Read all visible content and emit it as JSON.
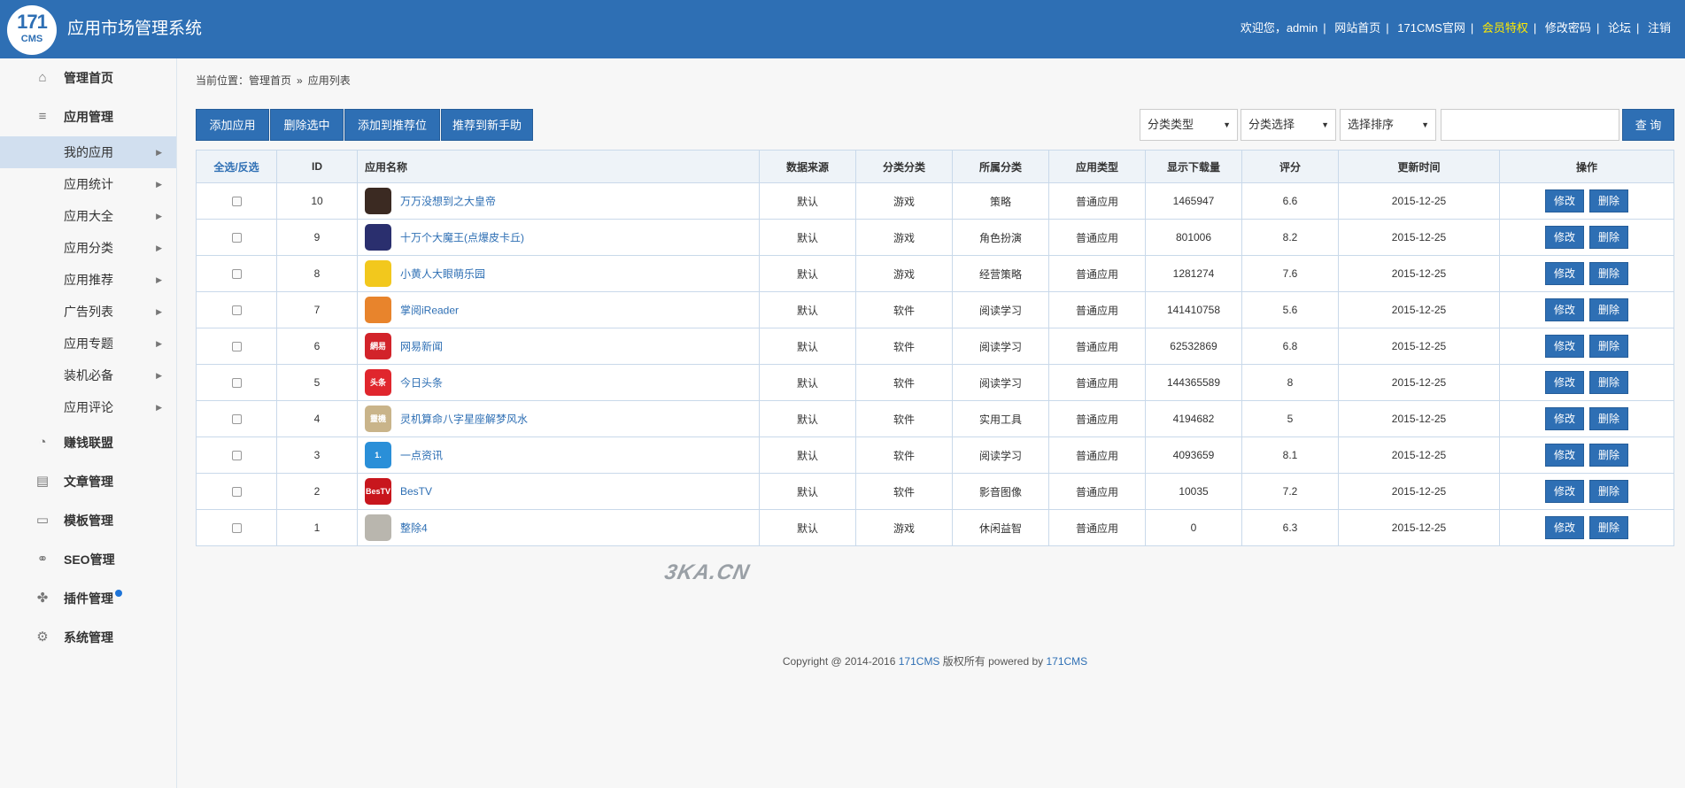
{
  "header": {
    "logo_num": "171",
    "logo_text": "CMS",
    "title": "应用市场管理系统",
    "welcome": "欢迎您，admin",
    "links": [
      "网站首页",
      "171CMS官网",
      "会员特权",
      "修改密码",
      "论坛",
      "注销"
    ]
  },
  "sidebar": {
    "home": "管理首页",
    "app_mgmt": "应用管理",
    "sub_items": [
      "我的应用",
      "应用统计",
      "应用大全",
      "应用分类",
      "应用推荐",
      "广告列表",
      "应用专题",
      "装机必备",
      "应用评论"
    ],
    "money": "赚钱联盟",
    "articles": "文章管理",
    "templates": "模板管理",
    "seo": "SEO管理",
    "plugins": "插件管理",
    "system": "系统管理"
  },
  "breadcrumb": {
    "label": "当前位置：",
    "home": "管理首页",
    "sep": "»",
    "current": "应用列表"
  },
  "toolbar": {
    "add": "添加应用",
    "delete_selected": "删除选中",
    "add_recommend": "添加到推荐位",
    "recommend_new": "推荐到新手助",
    "filter_type": "分类类型",
    "filter_category": "分类选择",
    "filter_sort": "选择排序",
    "search_value": "",
    "search_btn": "查 询"
  },
  "table": {
    "headers": [
      "全选/反选",
      "ID",
      "应用名称",
      "数据来源",
      "分类分类",
      "所属分类",
      "应用类型",
      "显示下载量",
      "评分",
      "更新时间",
      "操作"
    ],
    "edit_label": "修改",
    "delete_label": "删除",
    "rows": [
      {
        "id": "10",
        "name": "万万没想到之大皇帝",
        "source": "默认",
        "kind": "游戏",
        "cat": "策略",
        "type": "普通应用",
        "downloads": "1465947",
        "score": "6.6",
        "date": "2015-12-25",
        "icon_color": "#3b2a22",
        "icon_text": ""
      },
      {
        "id": "9",
        "name": "十万个大魔王(点爆皮卡丘)",
        "source": "默认",
        "kind": "游戏",
        "cat": "角色扮演",
        "type": "普通应用",
        "downloads": "801006",
        "score": "8.2",
        "date": "2015-12-25",
        "icon_color": "#2a2f6e",
        "icon_text": ""
      },
      {
        "id": "8",
        "name": "小黄人大眼萌乐园",
        "source": "默认",
        "kind": "游戏",
        "cat": "经营策略",
        "type": "普通应用",
        "downloads": "1281274",
        "score": "7.6",
        "date": "2015-12-25",
        "icon_color": "#f2c81d",
        "icon_text": ""
      },
      {
        "id": "7",
        "name": "掌阅iReader",
        "source": "默认",
        "kind": "软件",
        "cat": "阅读学习",
        "type": "普通应用",
        "downloads": "141410758",
        "score": "5.6",
        "date": "2015-12-25",
        "icon_color": "#e8842c",
        "icon_text": ""
      },
      {
        "id": "6",
        "name": "网易新闻",
        "source": "默认",
        "kind": "软件",
        "cat": "阅读学习",
        "type": "普通应用",
        "downloads": "62532869",
        "score": "6.8",
        "date": "2015-12-25",
        "icon_color": "#d2232a",
        "icon_text": "網易"
      },
      {
        "id": "5",
        "name": "今日头条",
        "source": "默认",
        "kind": "软件",
        "cat": "阅读学习",
        "type": "普通应用",
        "downloads": "144365589",
        "score": "8",
        "date": "2015-12-25",
        "icon_color": "#e0262d",
        "icon_text": "头条"
      },
      {
        "id": "4",
        "name": "灵机算命八字星座解梦风水",
        "source": "默认",
        "kind": "软件",
        "cat": "实用工具",
        "type": "普通应用",
        "downloads": "4194682",
        "score": "5",
        "date": "2015-12-25",
        "icon_color": "#c9b48a",
        "icon_text": "靈機"
      },
      {
        "id": "3",
        "name": "一点资讯",
        "source": "默认",
        "kind": "软件",
        "cat": "阅读学习",
        "type": "普通应用",
        "downloads": "4093659",
        "score": "8.1",
        "date": "2015-12-25",
        "icon_color": "#2a8fd8",
        "icon_text": "1."
      },
      {
        "id": "2",
        "name": "BesTV",
        "source": "默认",
        "kind": "软件",
        "cat": "影音图像",
        "type": "普通应用",
        "downloads": "10035",
        "score": "7.2",
        "date": "2015-12-25",
        "icon_color": "#c8161d",
        "icon_text": "BesTV"
      },
      {
        "id": "1",
        "name": "整除4",
        "source": "默认",
        "kind": "游戏",
        "cat": "休闲益智",
        "type": "普通应用",
        "downloads": "0",
        "score": "6.3",
        "date": "2015-12-25",
        "icon_color": "#b9b6ae",
        "icon_text": ""
      }
    ]
  },
  "watermark": "3KA.CN",
  "footer": {
    "prefix": "Copyright @ 2014-2016 ",
    "brand1": "171CMS",
    "middle": " 版权所有 powered by ",
    "brand2": "171CMS"
  }
}
